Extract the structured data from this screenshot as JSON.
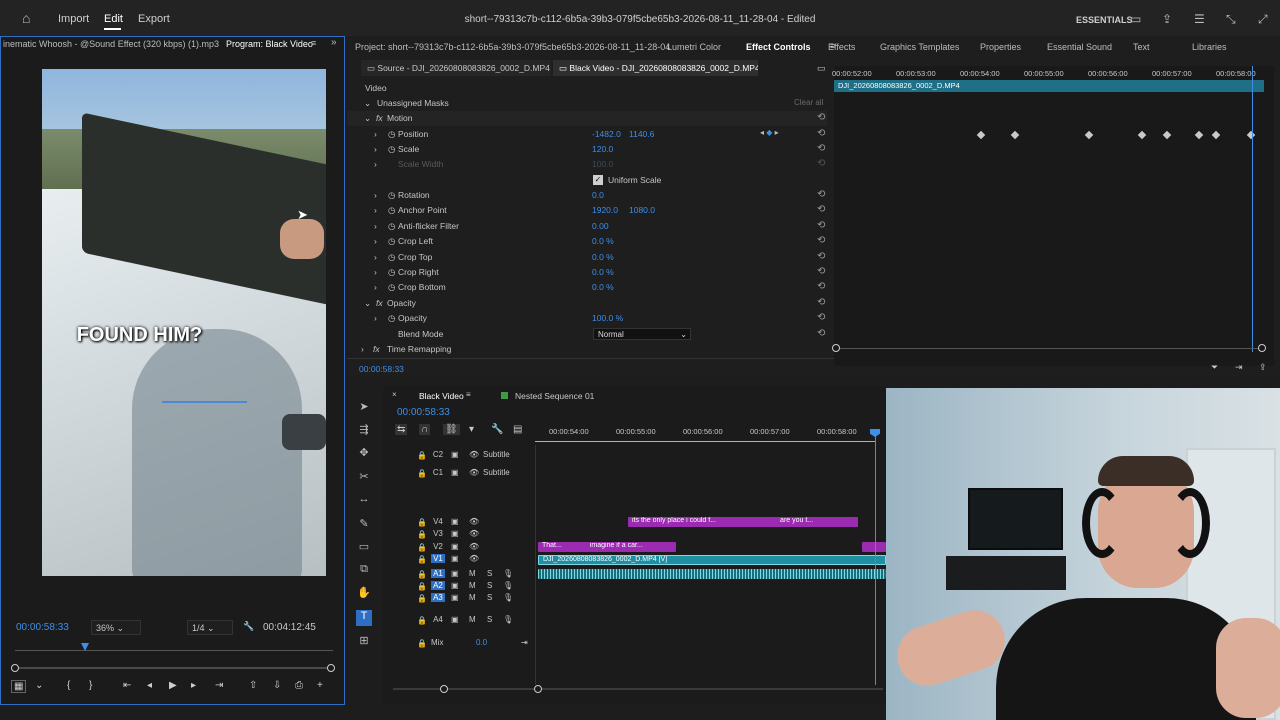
{
  "topbar": {
    "import": "Import",
    "edit": "Edit",
    "export": "Export",
    "title": "short--79313c7b-c112-6b5a-39b3-079f5cbe65b3-2026-08-11_11-28-04 - Edited",
    "workspace": "ESSENTIALS"
  },
  "program": {
    "source_tab": "inematic Whoosh - @Sound Effect (320 kbps) (1).mp3",
    "program_tab": "Program: Black Video",
    "caption": "FOUND HIM?",
    "timecode": "00:00:58:33",
    "zoom": "36%",
    "resolution": "1/4",
    "duration": "00:04:12:45"
  },
  "effect_panel": {
    "project_tab": "Project: short--79313c7b-c112-6b5a-39b3-079f5cbe65b3-2026-08-11_11-28-04",
    "tabs": [
      "Lumetri Color",
      "Effect Controls",
      "Effects",
      "Graphics Templates",
      "Properties",
      "Essential Sound",
      "Text",
      "Libraries"
    ],
    "source_tab": "Source - DJI_20260808083826_0002_D.MP4",
    "clip_tab": "Black Video - DJI_20260808083826_0002_D.MP4",
    "section_video": "Video",
    "unassigned_masks": "Unassigned Masks",
    "clear_all": "Clear all",
    "motion": "Motion",
    "opacity_group": "Opacity",
    "time_remapping": "Time Remapping",
    "uniform_scale": "Uniform Scale",
    "properties": [
      {
        "label": "Position",
        "v1": "-1482.0",
        "v2": "1140.6"
      },
      {
        "label": "Scale",
        "v1": "120.0",
        "v2": ""
      },
      {
        "label": "Scale Width",
        "v1": "100.0",
        "v2": ""
      },
      {
        "label": "Rotation",
        "v1": "0.0",
        "v2": ""
      },
      {
        "label": "Anchor Point",
        "v1": "1920.0",
        "v2": "1080.0"
      },
      {
        "label": "Anti-flicker Filter",
        "v1": "0.00",
        "v2": ""
      },
      {
        "label": "Crop Left",
        "v1": "0.0 %",
        "v2": ""
      },
      {
        "label": "Crop Top",
        "v1": "0.0 %",
        "v2": ""
      },
      {
        "label": "Crop Right",
        "v1": "0.0 %",
        "v2": ""
      },
      {
        "label": "Crop Bottom",
        "v1": "0.0 %",
        "v2": ""
      },
      {
        "label": "Opacity",
        "v1": "100.0 %",
        "v2": ""
      },
      {
        "label": "Blend Mode",
        "v1": "Normal",
        "v2": ""
      }
    ],
    "timecode": "00:00:58:33",
    "ruler": [
      "00:00:52:00",
      "00:00:53:00",
      "00:00:54:00",
      "00:00:55:00",
      "00:00:56:00",
      "00:00:57:00",
      "00:00:58:00"
    ],
    "clip_label": "DJI_20260808083826_0002_D.MP4"
  },
  "timeline": {
    "tab_active": "Black Video",
    "tab_other": "Nested Sequence 01",
    "timecode": "00:00:58:33",
    "ruler": [
      "00:00:54:00",
      "00:00:55:00",
      "00:00:56:00",
      "00:00:57:00",
      "00:00:58:00"
    ],
    "tracks": [
      "C2",
      "C1",
      "V4",
      "V3",
      "V2",
      "V1",
      "A1",
      "A2",
      "A3",
      "A4"
    ],
    "subtitle": "Subtitle",
    "mix_label": "Mix",
    "mix_value": "0.0",
    "clips": {
      "v4a": "its the only place i could f...",
      "v4b": "are you t...",
      "v2a": "That...",
      "v2b": "imagine if a car...",
      "v1": "DJI_20260808083826_0002_D.MP4 [V]"
    }
  },
  "colors": {
    "accent": "#2e6ec4",
    "value_blue": "#3f8ee8",
    "clip_magenta": "#9b2bb0",
    "clip_v1": "#1f8fa3",
    "clip_audio": "#1b6f7c"
  }
}
